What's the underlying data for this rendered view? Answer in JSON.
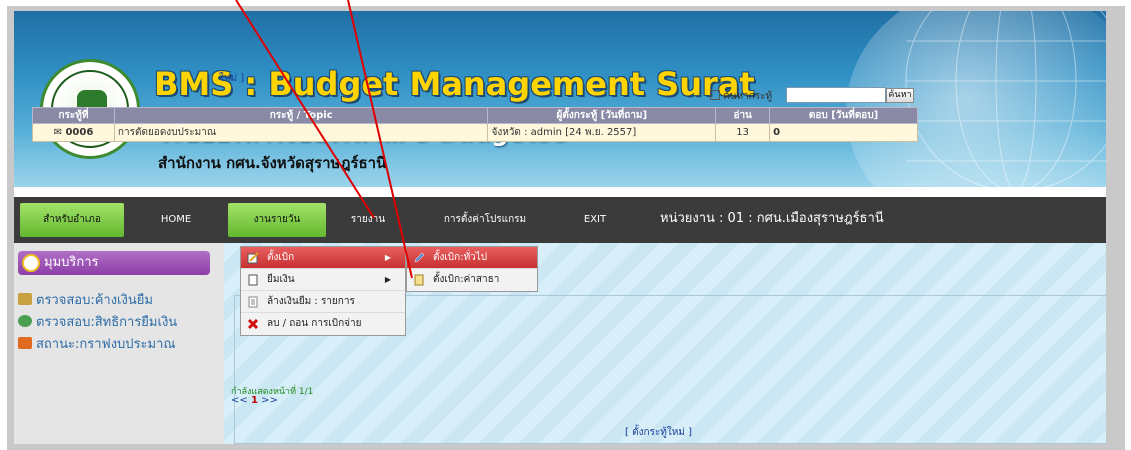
{
  "header": {
    "title_main": "BMS : Budget Management Surat",
    "title_sub": "ระบบบริหารงบประมาณ e-Budget59",
    "org": "สำนักงาน กศน.จังหวัดสุราษฎร์ธานี"
  },
  "nav": {
    "items": [
      "สำหรับอำเภอ",
      "HOME",
      "งานรายวัน",
      "รายงาน",
      "การตั้งค่าโปรแกรม",
      "EXIT"
    ],
    "unit": "หน่วยงาน : 01 : กศน.เมืองสุราษฎร์ธานี"
  },
  "menu": {
    "level1": [
      "ตั้งเบิก",
      "ยืมเงิน",
      "ล้างเงินยืม : รายการ",
      "ลบ / ถอน การเบิกจ่าย"
    ],
    "level2": [
      "ตั้งเบิก:ทั่วไป",
      "ตั้งเบิก:ค่าสาธา"
    ]
  },
  "sidebar": {
    "heading": "มุมบริการ",
    "links": [
      "ตรวจสอบ:ค้างเงินยืม",
      "ตรวจสอบ:สิทธิการยืมเงิน",
      "สถานะ:กราฟงบประมาณ"
    ]
  },
  "main": {
    "new_topic_top": "ใหม่ ]",
    "search_label": "ค้นหากระทู้",
    "search_value": "",
    "search_button": "ค้นหา",
    "columns": [
      "กระทู้ที่",
      "กระทู้ / Topic",
      "ผู้ตั้งกระทู้ [วันที่ถาม]",
      "อ่าน",
      "ตอบ [วันที่ตอบ]"
    ],
    "rows": [
      {
        "id": "0006",
        "topic": "การตัดยอดงบประมาณ",
        "poster": "จังหวัด : admin [24 พ.ย. 2557]",
        "reads": "13",
        "replies": "0"
      }
    ],
    "page_info": "กำลังแสดงหน้าที่ 1/1",
    "pager_prev": "<<",
    "pager_current": "1",
    "pager_next": ">>",
    "new_topic_bottom": "[ ตั้งกระทู้ใหม่ ]"
  },
  "colors": {
    "accent_green": "#63b82e",
    "menu_highlight": "#c83030",
    "annotation": "#e00000"
  }
}
